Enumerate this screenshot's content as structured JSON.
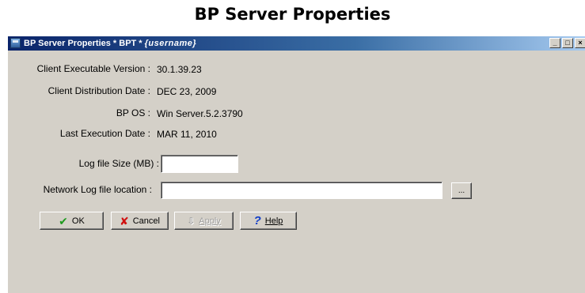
{
  "page": {
    "title": "BP Server Properties"
  },
  "window": {
    "title_prefix": "BP Server Properties  * BPT * ",
    "title_username": "{username}",
    "buttons": {
      "minimize": "_",
      "maximize": "□",
      "close": "×"
    }
  },
  "info": {
    "client_version_label": "Client Executable Version :",
    "client_version_value": "30.1.39.23",
    "distribution_date_label": "Client Distribution Date :",
    "distribution_date_value": "DEC 23, 2009",
    "bp_os_label": "BP OS :",
    "bp_os_value": "Win Server.5.2.3790",
    "last_execution_label": "Last Execution Date :",
    "last_execution_value": "MAR 11, 2010"
  },
  "form": {
    "log_size_label": "Log file Size (MB) :",
    "log_size_value": "",
    "network_log_label": "Network Log file location :",
    "network_log_value": "",
    "browse_label": "..."
  },
  "buttons": {
    "ok_label": "OK",
    "cancel_label": "Cancel",
    "apply_label": "Apply",
    "help_label": "Help"
  },
  "icons": {
    "ok": "checkmark-icon",
    "cancel": "x-icon",
    "apply": "apply-icon",
    "help": "question-mark-icon"
  },
  "colors": {
    "dialog_background": "#d4d0c8",
    "titlebar_start": "#0a246a",
    "ok_icon": "#1e9a1e",
    "cancel_icon": "#d01010",
    "help_icon": "#1440c8"
  }
}
